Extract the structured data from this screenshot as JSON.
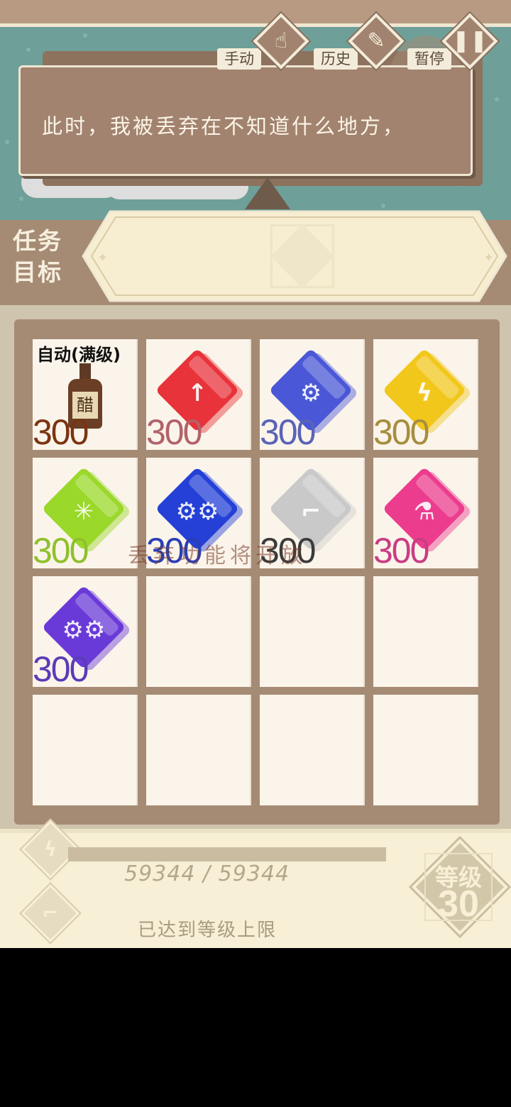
{
  "top_buttons": [
    {
      "label": "手动",
      "icon": "hand-refresh-icon"
    },
    {
      "label": "历史",
      "icon": "feather-icon"
    },
    {
      "label": "暂停",
      "icon": "pause-icon"
    }
  ],
  "dialog": {
    "text": "此时，我被丢弃在不知道什么地方，"
  },
  "task": {
    "label_line1": "任务",
    "label_line2": "目标"
  },
  "board": {
    "overlay_text": "丢弃功能将开放",
    "cells": [
      {
        "type": "bottle",
        "tag": "自动(满级)",
        "bottle_label": "醋",
        "count": "300",
        "count_color": "#7a3412"
      },
      {
        "type": "gem",
        "color": "#e8333a",
        "icon": "arrow-up-icon",
        "glyph": "↑",
        "count": "300",
        "count_color": "#b2626a"
      },
      {
        "type": "gem",
        "color": "#4a57d6",
        "icon": "gear-icon",
        "glyph": "⚙",
        "count": "300",
        "count_color": "#5a63b8"
      },
      {
        "type": "gem",
        "color": "#f2c71c",
        "icon": "lightning-icon",
        "glyph": "ϟ",
        "count": "300",
        "count_color": "#a78d3e"
      },
      {
        "type": "gem",
        "color": "#9ad82a",
        "icon": "sparkle-icon",
        "glyph": "✳",
        "count": "300",
        "count_color": "#8fc02c"
      },
      {
        "type": "gem",
        "color": "#2440d6",
        "icon": "gears-icon",
        "glyph": "⚙⚙",
        "count": "300",
        "count_color": "#2a3fb6"
      },
      {
        "type": "gem",
        "color": "#c9c9c9",
        "icon": "stairs-icon",
        "glyph": "⌐",
        "count": "300",
        "count_color": "#3b3b3b"
      },
      {
        "type": "gem",
        "color": "#ec3c8e",
        "icon": "flask-icon",
        "glyph": "⚗",
        "count": "300",
        "count_color": "#c83d84"
      },
      {
        "type": "gem",
        "color": "#6a3ad8",
        "icon": "gears-icon",
        "glyph": "⚙⚙",
        "count": "300",
        "count_color": "#5a3cb8"
      },
      {
        "type": "empty"
      },
      {
        "type": "empty"
      },
      {
        "type": "empty"
      },
      {
        "type": "empty"
      },
      {
        "type": "empty"
      },
      {
        "type": "empty"
      },
      {
        "type": "empty"
      }
    ]
  },
  "level": {
    "xp_text": "59344 / 59344",
    "xp_fraction": 1.0,
    "max_text": "已达到等级上限",
    "label": "等级",
    "value": "30"
  },
  "side_icons": [
    "lightning-icon",
    "stairs-icon"
  ]
}
